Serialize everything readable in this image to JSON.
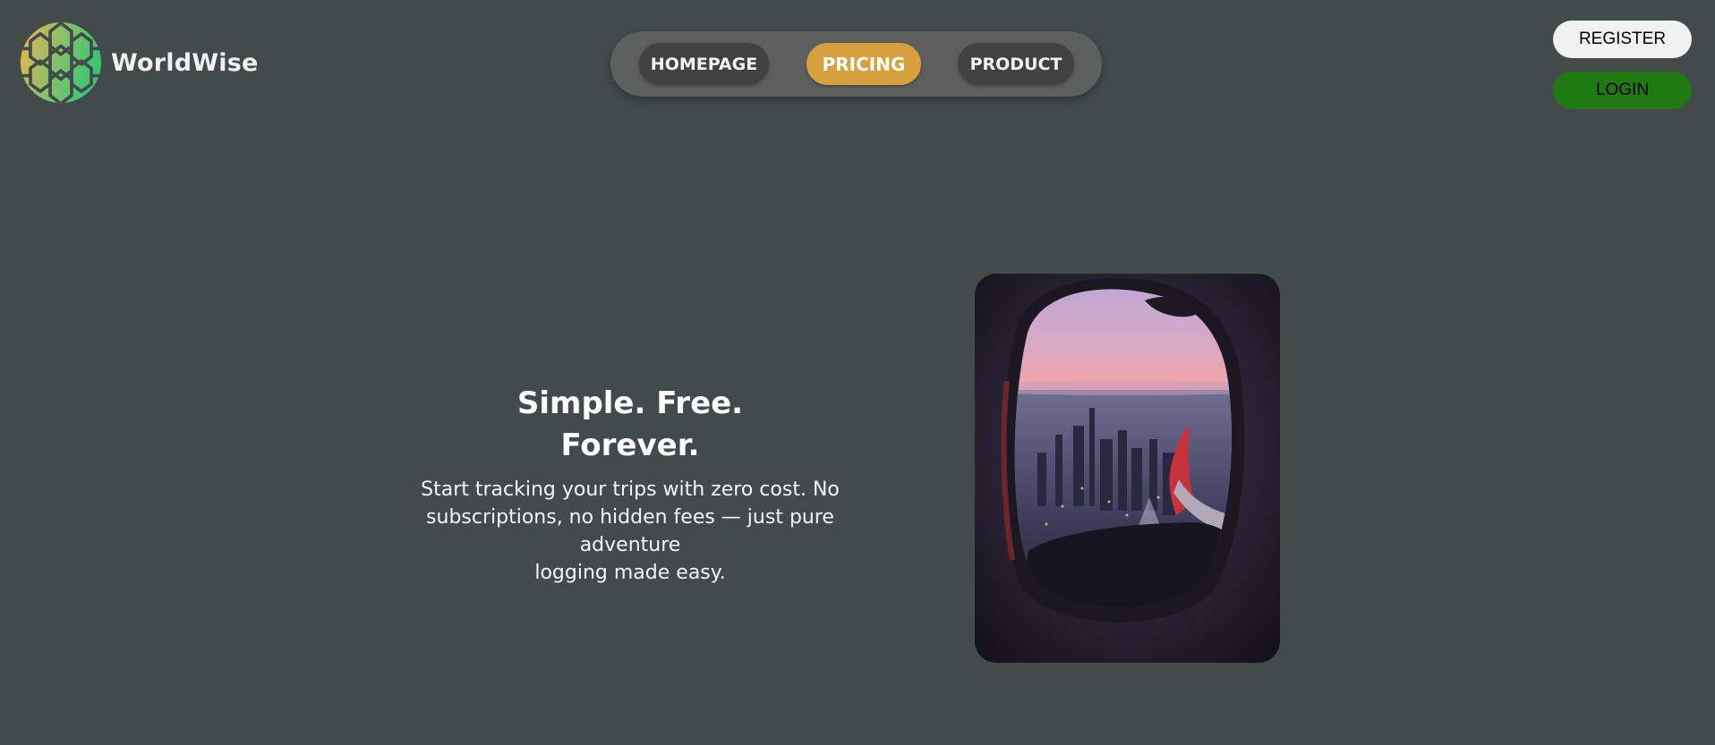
{
  "brand": {
    "name": "WorldWise",
    "logo_icon": "globe-hexagon-icon",
    "logo_colors": [
      "#f6b34a",
      "#8cc06a",
      "#3cc671"
    ]
  },
  "nav": {
    "items": [
      {
        "label": "HOMEPAGE",
        "active": false
      },
      {
        "label": "PRICING",
        "active": true
      },
      {
        "label": "PRODUCT",
        "active": false
      }
    ],
    "active_color": "#d6a03c"
  },
  "auth": {
    "register_label": "REGISTER",
    "login_label": "LOGIN",
    "login_color": "#1f7a12"
  },
  "hero": {
    "title_line1": "Simple. Free.",
    "title_line2": "Forever.",
    "subtitle_line1": "Start tracking your trips with zero cost. No",
    "subtitle_line2": "subscriptions, no hidden fees — just pure adventure",
    "subtitle_line3": "logging made easy.",
    "image": "airplane-window-city-sunset-photo"
  },
  "theme": {
    "background": "#424a4a"
  }
}
